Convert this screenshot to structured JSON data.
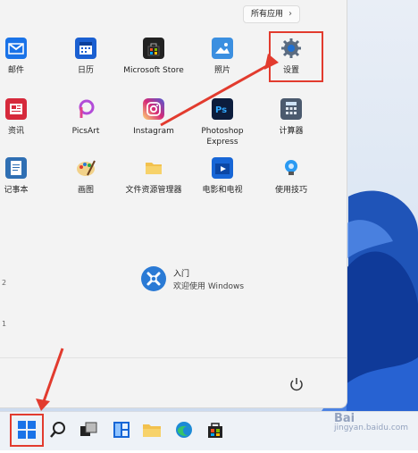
{
  "all_apps_button": {
    "label": "所有应用",
    "chevron": "›"
  },
  "pinned": [
    {
      "label": "邮件",
      "icon": "mail-icon",
      "color": "#1a73e8"
    },
    {
      "label": "日历",
      "icon": "calendar-icon",
      "color": "#1a5fd1"
    },
    {
      "label": "Microsoft Store",
      "icon": "store-icon",
      "color": "#222222"
    },
    {
      "label": "照片",
      "icon": "photos-icon",
      "color": "#3b8fe0"
    },
    {
      "label": "设置",
      "icon": "gear-icon",
      "color": "#5a6b80"
    },
    {
      "label": "资讯",
      "icon": "news-icon",
      "color": "#d6293b"
    },
    {
      "label": "PicsArt",
      "icon": "picsart-icon",
      "color": "#b24bd8"
    },
    {
      "label": "Instagram",
      "icon": "instagram-icon",
      "color": "#d6336c"
    },
    {
      "label": "Photoshop Express",
      "icon": "photoshop-icon",
      "color": "#0c1d3d"
    },
    {
      "label": "计算器",
      "icon": "calculator-icon",
      "color": "#4b5a6e"
    },
    {
      "label": "记事本",
      "icon": "notepad-icon",
      "color": "#2f6fb3"
    },
    {
      "label": "画图",
      "icon": "paint-icon",
      "color": "#e0a526"
    },
    {
      "label": "文件资源管理器",
      "icon": "folder-icon",
      "color": "#f2c14e"
    },
    {
      "label": "电影和电视",
      "icon": "movies-icon",
      "color": "#1766d6"
    },
    {
      "label": "使用技巧",
      "icon": "tips-icon",
      "color": "#2a9af2"
    }
  ],
  "recommended": {
    "title": "入门",
    "subtitle": "欢迎使用 Windows",
    "icon": "get-started-icon"
  },
  "edge_digits": [
    "2",
    "1"
  ],
  "power": {
    "icon": "power-icon"
  },
  "taskbar": {
    "items": [
      "start-icon",
      "search-icon",
      "task-view-icon",
      "widgets-icon",
      "file-explorer-icon",
      "edge-icon",
      "store-icon"
    ]
  },
  "watermark": {
    "text": "Bai",
    "sub": "jingyan.baidu.com"
  },
  "colors": {
    "highlight": "#e23b2e",
    "accent": "#0067c0"
  }
}
